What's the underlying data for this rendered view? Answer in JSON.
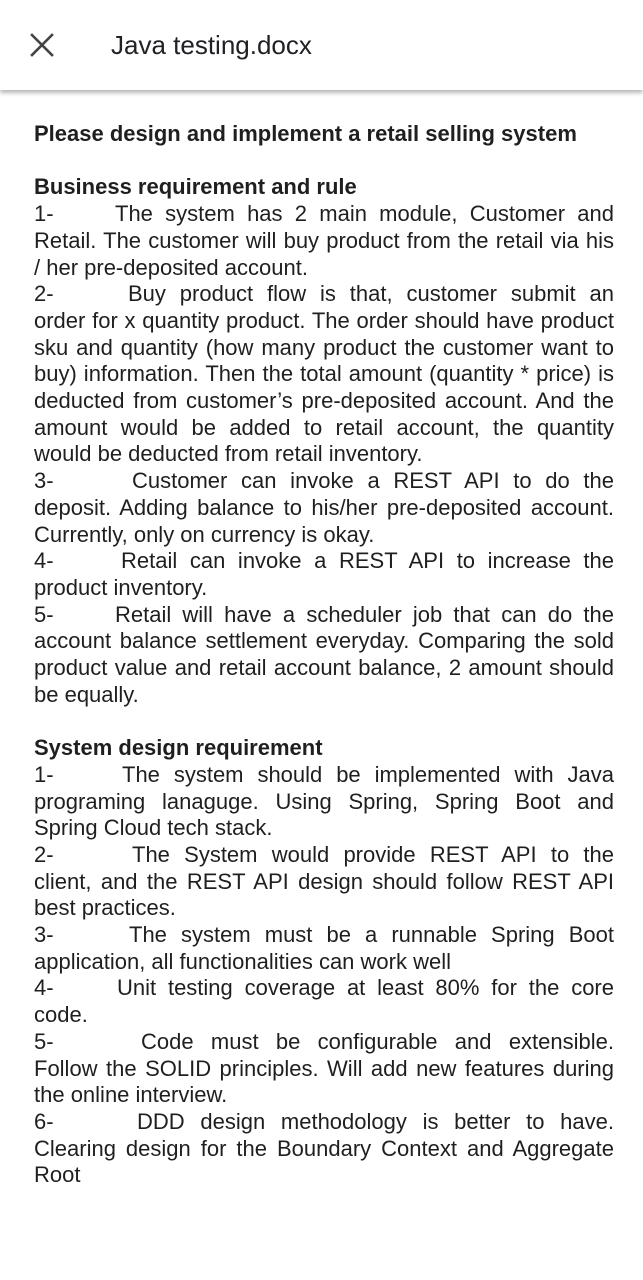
{
  "header": {
    "title": "Java testing.docx",
    "close_icon": "close-icon"
  },
  "document": {
    "title": "Please design and implement a retail selling system",
    "section1": {
      "heading": "Business requirement and rule",
      "items": [
        {
          "num": "1-",
          "text": "The system has 2 main module, Customer and Retail. The customer will buy product from the retail via his / her pre-deposited account."
        },
        {
          "num": "2-",
          "text": "Buy product flow is that, customer submit an order for x quantity product. The order should have product sku and quantity (how many product the customer want to buy) information. Then the total amount (quantity * price) is deducted from customer’s pre-deposited account. And the amount would be added to retail account, the quantity would be deducted from retail inventory."
        },
        {
          "num": "3-",
          "text": "Customer can invoke a REST API to do the deposit. Adding balance to his/her pre-deposited account. Currently, only on currency is okay."
        },
        {
          "num": "4-",
          "text": "Retail can invoke a REST API to increase the product inventory."
        },
        {
          "num": "5-",
          "text": "Retail will have a scheduler job that can do the account balance settlement everyday. Comparing the sold product value and retail account balance, 2 amount should be equally."
        }
      ]
    },
    "section2": {
      "heading": "System design requirement",
      "items": [
        {
          "num": "1-",
          "text": "The system should be implemented with Java programing lanaguge. Using Spring, Spring Boot and Spring Cloud tech stack."
        },
        {
          "num": "2-",
          "text": "The System would provide REST API to the client, and the REST API design should follow REST API best practices."
        },
        {
          "num": "3-",
          "text": "The system must be a runnable Spring Boot application, all functionalities can work well"
        },
        {
          "num": "4-",
          "text": "Unit testing coverage at least 80% for the core code."
        },
        {
          "num": "5-",
          "text": "Code must be configurable and extensible. Follow the SOLID principles. Will add new features during the online interview."
        },
        {
          "num": "6-",
          "text": "DDD design methodology is better to have. Clearing design for the Boundary Context and Aggregate Root"
        }
      ]
    }
  }
}
